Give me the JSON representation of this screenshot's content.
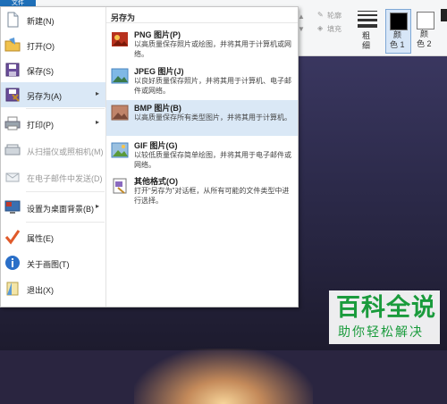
{
  "ribbon": {
    "file_tab": "文件",
    "outline_label": "轮廓",
    "fill_label": "填充",
    "size_label_1": "粗",
    "size_label_2": "细",
    "color1_label_1": "颜",
    "color1_label_2": "色 1",
    "color2_label_1": "颜",
    "color2_label_2": "色 2",
    "color1_value": "#000000",
    "color2_value": "#ffffff"
  },
  "menu": {
    "items": [
      {
        "label": "新建(N)",
        "icon": "new-file-icon",
        "has_submenu": false
      },
      {
        "label": "打开(O)",
        "icon": "open-folder-icon",
        "has_submenu": false
      },
      {
        "label": "保存(S)",
        "icon": "save-disk-icon",
        "has_submenu": false
      },
      {
        "label": "另存为(A)",
        "icon": "save-as-icon",
        "has_submenu": true
      },
      {
        "label": "打印(P)",
        "icon": "printer-icon",
        "has_submenu": true
      },
      {
        "label": "从扫描仪或照相机(M)",
        "icon": "scanner-icon",
        "has_submenu": false
      },
      {
        "label": "在电子邮件中发送(D)",
        "icon": "email-icon",
        "has_submenu": false
      },
      {
        "label": "设置为桌面背景(B)",
        "icon": "desktop-background-icon",
        "has_submenu": true
      },
      {
        "label": "属性(E)",
        "icon": "checkmark-icon",
        "has_submenu": false
      },
      {
        "label": "关于画图(T)",
        "icon": "info-icon",
        "has_submenu": false
      },
      {
        "label": "退出(X)",
        "icon": "exit-icon",
        "has_submenu": false
      }
    ],
    "arrow_glyph": "▸"
  },
  "save_as_panel": {
    "title": "另存为",
    "formats": [
      {
        "name": "PNG 图片(P)",
        "desc": "以高质量保存照片或绘图，并将其用于计算机或网络。",
        "icon": "png-image-icon"
      },
      {
        "name": "JPEG 图片(J)",
        "desc": "以良好质量保存照片，并将其用于计算机、电子邮件或网络。",
        "icon": "jpeg-image-icon"
      },
      {
        "name": "BMP 图片(B)",
        "desc": "以高质量保存所有类型图片，并将其用于计算机。",
        "icon": "bmp-image-icon"
      },
      {
        "name": "GIF 图片(G)",
        "desc": "以较低质量保存简单绘图，并将其用于电子邮件或网络。",
        "icon": "gif-image-icon"
      },
      {
        "name": "其他格式(O)",
        "desc": "打开“另存为”对话框，从所有可能的文件类型中进行选择。",
        "icon": "other-formats-icon"
      }
    ]
  },
  "watermark": {
    "title": "百科全说",
    "subtitle": "助你轻松解决"
  }
}
